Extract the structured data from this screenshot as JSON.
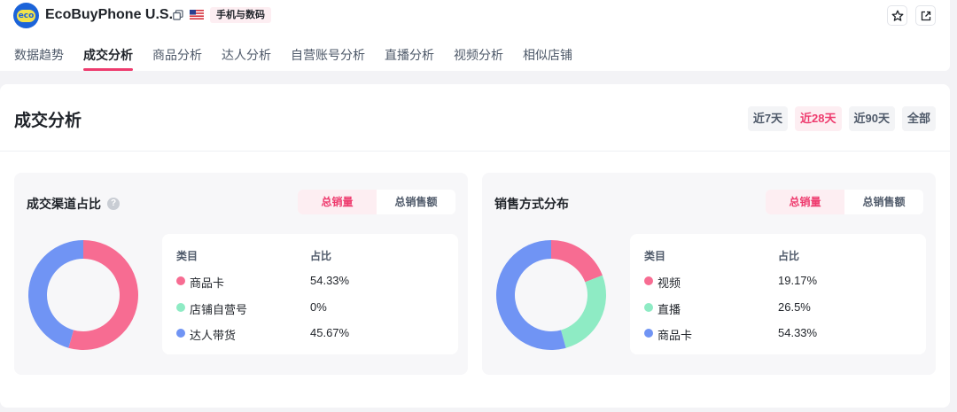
{
  "shop": {
    "logo_text": "eco",
    "name": "EcoBuyPhone U.S.",
    "category": "手机与数码",
    "icons": [
      "copy-icon",
      "us-flag-icon",
      "star-icon",
      "external-link-icon"
    ]
  },
  "tabs": [
    {
      "label": "数据趋势",
      "active": false
    },
    {
      "label": "成交分析",
      "active": true
    },
    {
      "label": "商品分析",
      "active": false
    },
    {
      "label": "达人分析",
      "active": false
    },
    {
      "label": "自营账号分析",
      "active": false
    },
    {
      "label": "直播分析",
      "active": false
    },
    {
      "label": "视频分析",
      "active": false
    },
    {
      "label": "相似店铺",
      "active": false
    }
  ],
  "section": {
    "title": "成交分析",
    "ranges": [
      {
        "label": "近7天",
        "active": false
      },
      {
        "label": "近28天",
        "active": true
      },
      {
        "label": "近90天",
        "active": false
      },
      {
        "label": "全部",
        "active": false
      }
    ]
  },
  "colors": {
    "accent": "#ee3b6e",
    "pink": "#f76c92",
    "green": "#8eebc4",
    "blue": "#7094f4"
  },
  "panels": [
    {
      "title": "成交渠道占比",
      "has_help": true,
      "help_glyph": "?",
      "metrics": [
        {
          "label": "总销量",
          "active": true
        },
        {
          "label": "总销售额",
          "active": false
        }
      ],
      "col_category": "类目",
      "col_share": "占比",
      "rows": [
        {
          "name": "商品卡",
          "value": "54.33%",
          "color": "#f76c92"
        },
        {
          "name": "店铺自营号",
          "value": "0%",
          "color": "#8eebc4"
        },
        {
          "name": "达人带货",
          "value": "45.67%",
          "color": "#7094f4"
        }
      ]
    },
    {
      "title": "销售方式分布",
      "has_help": false,
      "metrics": [
        {
          "label": "总销量",
          "active": true
        },
        {
          "label": "总销售额",
          "active": false
        }
      ],
      "col_category": "类目",
      "col_share": "占比",
      "rows": [
        {
          "name": "视频",
          "value": "19.17%",
          "color": "#f76c92"
        },
        {
          "name": "直播",
          "value": "26.5%",
          "color": "#8eebc4"
        },
        {
          "name": "商品卡",
          "value": "54.33%",
          "color": "#7094f4"
        }
      ]
    }
  ],
  "chart_data": [
    {
      "type": "pie",
      "title": "成交渠道占比",
      "categories": [
        "商品卡",
        "店铺自营号",
        "达人带货"
      ],
      "values": [
        54.33,
        0,
        45.67
      ],
      "colors": [
        "#f76c92",
        "#8eebc4",
        "#7094f4"
      ],
      "donut": true
    },
    {
      "type": "pie",
      "title": "销售方式分布",
      "categories": [
        "视频",
        "直播",
        "商品卡"
      ],
      "values": [
        19.17,
        26.5,
        54.33
      ],
      "colors": [
        "#f76c92",
        "#8eebc4",
        "#7094f4"
      ],
      "donut": true
    }
  ]
}
